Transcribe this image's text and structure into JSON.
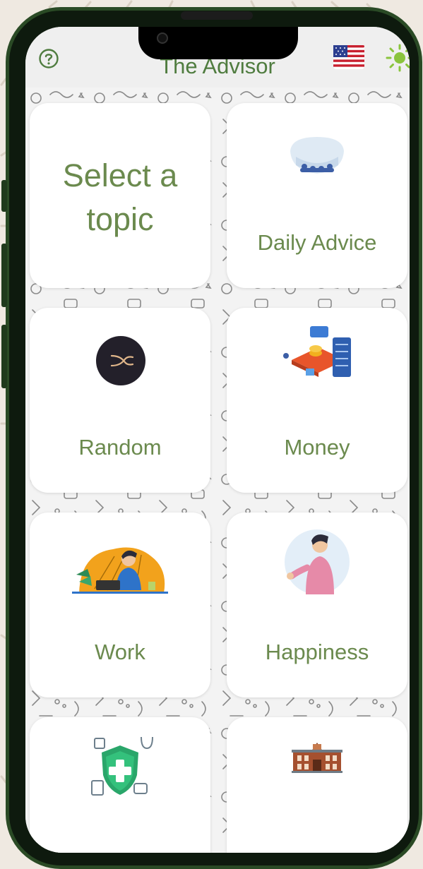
{
  "app": {
    "title": "The Advisor",
    "help_icon": "help-circle-icon",
    "language_icon": "us-flag-icon",
    "theme_icon": "sun-icon"
  },
  "grid": {
    "intro": "Select a topic",
    "topics": [
      {
        "label": "Daily Advice",
        "icon": "mouthguard-icon"
      },
      {
        "label": "Random",
        "icon": "random-shuffle-icon"
      },
      {
        "label": "Money",
        "icon": "money-servers-icon"
      },
      {
        "label": "Work",
        "icon": "person-at-laptop-icon"
      },
      {
        "label": "Happiness",
        "icon": "waving-person-icon"
      },
      {
        "label": "",
        "icon": "health-shield-icon"
      },
      {
        "label": "",
        "icon": "school-building-icon"
      }
    ]
  },
  "colors": {
    "accent": "#6b8a4e",
    "frame": "#0e1a0e",
    "frame_border": "#2a4a25",
    "card": "#ffffff",
    "random_circle": "#23202a",
    "random_mark": "#e0b68a"
  }
}
